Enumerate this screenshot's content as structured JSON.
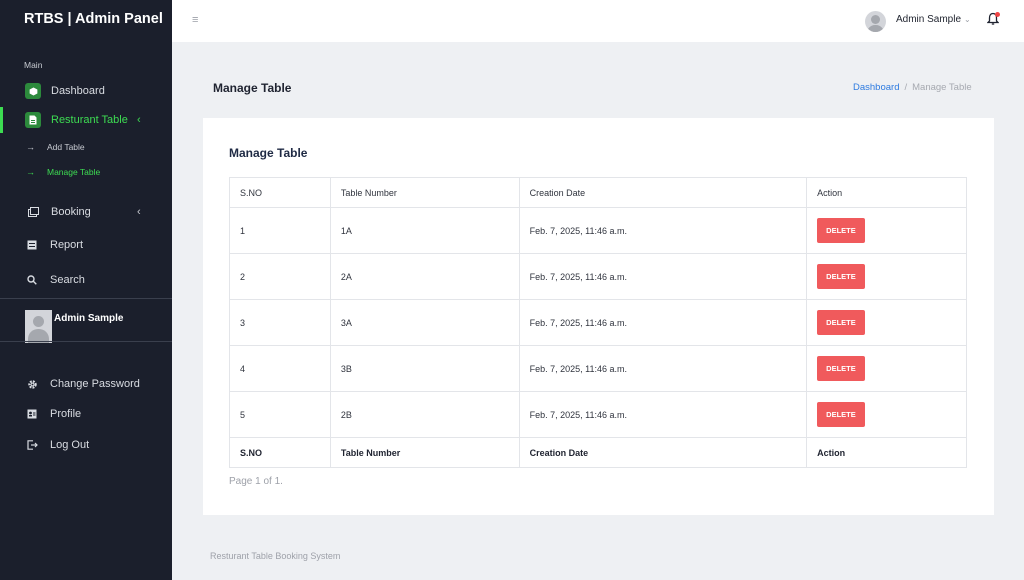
{
  "brand": "RTBS | Admin Panel",
  "sidebar": {
    "section_label": "Main",
    "items": [
      {
        "label": "Dashboard",
        "icon": "cube-icon"
      },
      {
        "label": "Resturant Table",
        "icon": "document-icon",
        "chevron": "‹",
        "active": true
      },
      {
        "label": "Add Table",
        "icon": "arrow-right-icon"
      },
      {
        "label": "Manage Table",
        "icon": "arrow-right-icon",
        "active": true
      },
      {
        "label": "Booking",
        "icon": "booking-icon",
        "chevron": "‹"
      },
      {
        "label": "Report",
        "icon": "report-icon"
      },
      {
        "label": "Search",
        "icon": "search-icon"
      }
    ],
    "user_name": "Admin Sample",
    "account_items": [
      {
        "label": "Change Password",
        "icon": "gear-icon"
      },
      {
        "label": "Profile",
        "icon": "id-card-icon"
      },
      {
        "label": "Log Out",
        "icon": "logout-icon"
      }
    ]
  },
  "topbar": {
    "menu_icon": "≡",
    "user_name": "Admin Sample",
    "caret": "⌄"
  },
  "page": {
    "title": "Manage Table",
    "breadcrumb": {
      "link": "Dashboard",
      "separator": "/",
      "current": "Manage Table"
    }
  },
  "card": {
    "title": "Manage Table",
    "columns": [
      "S.NO",
      "Table Number",
      "Creation Date",
      "Action"
    ],
    "rows": [
      {
        "sno": "1",
        "table_number": "1A",
        "date": "Feb. 7, 2025, 11:46 a.m.",
        "action": "DELETE"
      },
      {
        "sno": "2",
        "table_number": "2A",
        "date": "Feb. 7, 2025, 11:46 a.m.",
        "action": "DELETE"
      },
      {
        "sno": "3",
        "table_number": "3A",
        "date": "Feb. 7, 2025, 11:46 a.m.",
        "action": "DELETE"
      },
      {
        "sno": "4",
        "table_number": "3B",
        "date": "Feb. 7, 2025, 11:46 a.m.",
        "action": "DELETE"
      },
      {
        "sno": "5",
        "table_number": "2B",
        "date": "Feb. 7, 2025, 11:46 a.m.",
        "action": "DELETE"
      }
    ],
    "pagination": "Page 1 of 1."
  },
  "footer": "Resturant Table Booking System",
  "colors": {
    "sidebar_bg": "#1b1f2c",
    "active": "#3ddc52",
    "delete_button": "#f05a5c",
    "breadcrumb_link": "#2e7be0"
  }
}
